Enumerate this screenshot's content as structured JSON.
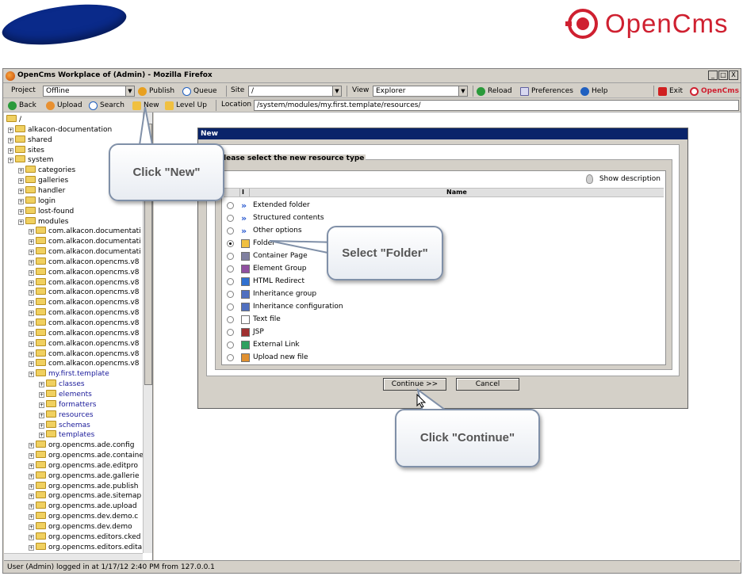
{
  "brand": {
    "name": "OpenCms",
    "color": "#cf2030"
  },
  "window": {
    "title": "OpenCms Workplace of (Admin) - Mozilla Firefox",
    "buttons": [
      "_",
      "□",
      "X"
    ]
  },
  "toolbar": {
    "project_label": "Project",
    "project_value": "Offline",
    "publish": "Publish",
    "queue": "Queue",
    "site_label": "Site",
    "site_value": "/",
    "view_label": "View",
    "view_value": "Explorer",
    "reload": "Reload",
    "preferences": "Preferences",
    "help": "Help",
    "exit": "Exit",
    "exit_brand": "OpenCms"
  },
  "nav": {
    "back": "Back",
    "upload": "Upload",
    "search": "Search",
    "new": "New",
    "level_up": "Level Up",
    "location_label": "Location",
    "location_value": "/system/modules/my.first.template/resources/"
  },
  "tree": {
    "items": [
      {
        "label": "/",
        "depth": 0
      },
      {
        "label": "alkacon-documentation",
        "depth": 1
      },
      {
        "label": "shared",
        "depth": 1
      },
      {
        "label": "sites",
        "depth": 1
      },
      {
        "label": "system",
        "depth": 1
      },
      {
        "label": "categories",
        "depth": 2
      },
      {
        "label": "galleries",
        "depth": 2
      },
      {
        "label": "handler",
        "depth": 2
      },
      {
        "label": "login",
        "depth": 2
      },
      {
        "label": "lost-found",
        "depth": 2
      },
      {
        "label": "modules",
        "depth": 2
      },
      {
        "label": "com.alkacon.documentati",
        "depth": 3
      },
      {
        "label": "com.alkacon.documentati",
        "depth": 3
      },
      {
        "label": "com.alkacon.documentati",
        "depth": 3
      },
      {
        "label": "com.alkacon.opencms.v8",
        "depth": 3
      },
      {
        "label": "com.alkacon.opencms.v8",
        "depth": 3
      },
      {
        "label": "com.alkacon.opencms.v8",
        "depth": 3
      },
      {
        "label": "com.alkacon.opencms.v8",
        "depth": 3
      },
      {
        "label": "com.alkacon.opencms.v8",
        "depth": 3
      },
      {
        "label": "com.alkacon.opencms.v8",
        "depth": 3
      },
      {
        "label": "com.alkacon.opencms.v8",
        "depth": 3
      },
      {
        "label": "com.alkacon.opencms.v8",
        "depth": 3
      },
      {
        "label": "com.alkacon.opencms.v8",
        "depth": 3
      },
      {
        "label": "com.alkacon.opencms.v8",
        "depth": 3
      },
      {
        "label": "com.alkacon.opencms.v8",
        "depth": 3
      },
      {
        "label": "my.first.template",
        "depth": 3,
        "blue": true
      },
      {
        "label": "classes",
        "depth": 4,
        "blue": true
      },
      {
        "label": "elements",
        "depth": 4,
        "blue": true
      },
      {
        "label": "formatters",
        "depth": 4,
        "blue": true
      },
      {
        "label": "resources",
        "depth": 4,
        "blue": true
      },
      {
        "label": "schemas",
        "depth": 4,
        "blue": true
      },
      {
        "label": "templates",
        "depth": 4,
        "blue": true
      },
      {
        "label": "org.opencms.ade.config",
        "depth": 3
      },
      {
        "label": "org.opencms.ade.containe",
        "depth": 3
      },
      {
        "label": "org.opencms.ade.editpro",
        "depth": 3
      },
      {
        "label": "org.opencms.ade.gallerie",
        "depth": 3
      },
      {
        "label": "org.opencms.ade.publish",
        "depth": 3
      },
      {
        "label": "org.opencms.ade.sitemap",
        "depth": 3
      },
      {
        "label": "org.opencms.ade.upload",
        "depth": 3
      },
      {
        "label": "org.opencms.dev.demo.c",
        "depth": 3
      },
      {
        "label": "org.opencms.dev.demo",
        "depth": 3
      },
      {
        "label": "org.opencms.editors.cked",
        "depth": 3
      },
      {
        "label": "org.opencms.editors.edita",
        "depth": 3
      }
    ]
  },
  "dialog": {
    "title": "New",
    "legend": "lease select the new resource type",
    "show_description": "Show description",
    "col_i": "I",
    "col_name": "Name",
    "rows": [
      {
        "label": "Extended folder",
        "icon": "chevron-double-icon",
        "selected": false
      },
      {
        "label": "Structured contents",
        "icon": "chevron-double-icon",
        "selected": false
      },
      {
        "label": "Other options",
        "icon": "chevron-double-icon",
        "selected": false
      },
      {
        "label": "Folder",
        "icon": "folder-icon",
        "selected": true
      },
      {
        "label": "Container Page",
        "icon": "container-page-icon",
        "selected": false
      },
      {
        "label": "Element Group",
        "icon": "element-group-icon",
        "selected": false
      },
      {
        "label": "HTML Redirect",
        "icon": "globe-icon",
        "selected": false
      },
      {
        "label": "Inheritance group",
        "icon": "inheritance-icon",
        "selected": false
      },
      {
        "label": "Inheritance configuration",
        "icon": "inheritance-config-icon",
        "selected": false
      },
      {
        "label": "Text file",
        "icon": "text-file-icon",
        "selected": false
      },
      {
        "label": "JSP",
        "icon": "jsp-icon",
        "selected": false
      },
      {
        "label": "External Link",
        "icon": "external-link-icon",
        "selected": false
      },
      {
        "label": "Upload new file",
        "icon": "upload-icon",
        "selected": false
      }
    ],
    "continue": "Continue >>",
    "cancel": "Cancel"
  },
  "callouts": {
    "new": "Click \"New\"",
    "folder": "Select \"Folder\"",
    "continue": "Click \"Continue\""
  },
  "status": "User (Admin) logged in at 1/17/12 2:40 PM from 127.0.0.1"
}
